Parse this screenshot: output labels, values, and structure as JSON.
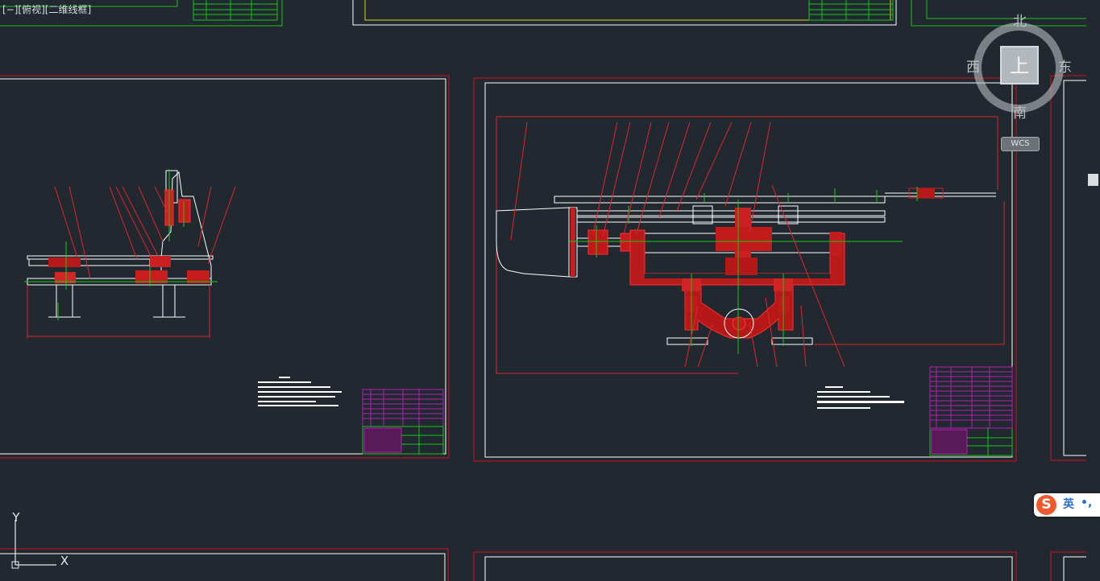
{
  "viewport": {
    "label": "[−][俯视][二维线框]"
  },
  "viewcube": {
    "north": "北",
    "south": "南",
    "east": "东",
    "west": "西",
    "top_face": "上",
    "wcs": "WCS"
  },
  "ucs": {
    "x_label": "X",
    "y_label": "Y"
  },
  "ime": {
    "logo": "S",
    "lang": "英",
    "punct": "•,"
  },
  "colors": {
    "background": "#212830",
    "frame": "#d4111a",
    "sheet": "#ffffff",
    "part": "#e8282e",
    "centerline": "#16c916",
    "leader": "#e0262b",
    "table": "#b51fb5",
    "yellow_frame": "#d6d318"
  }
}
